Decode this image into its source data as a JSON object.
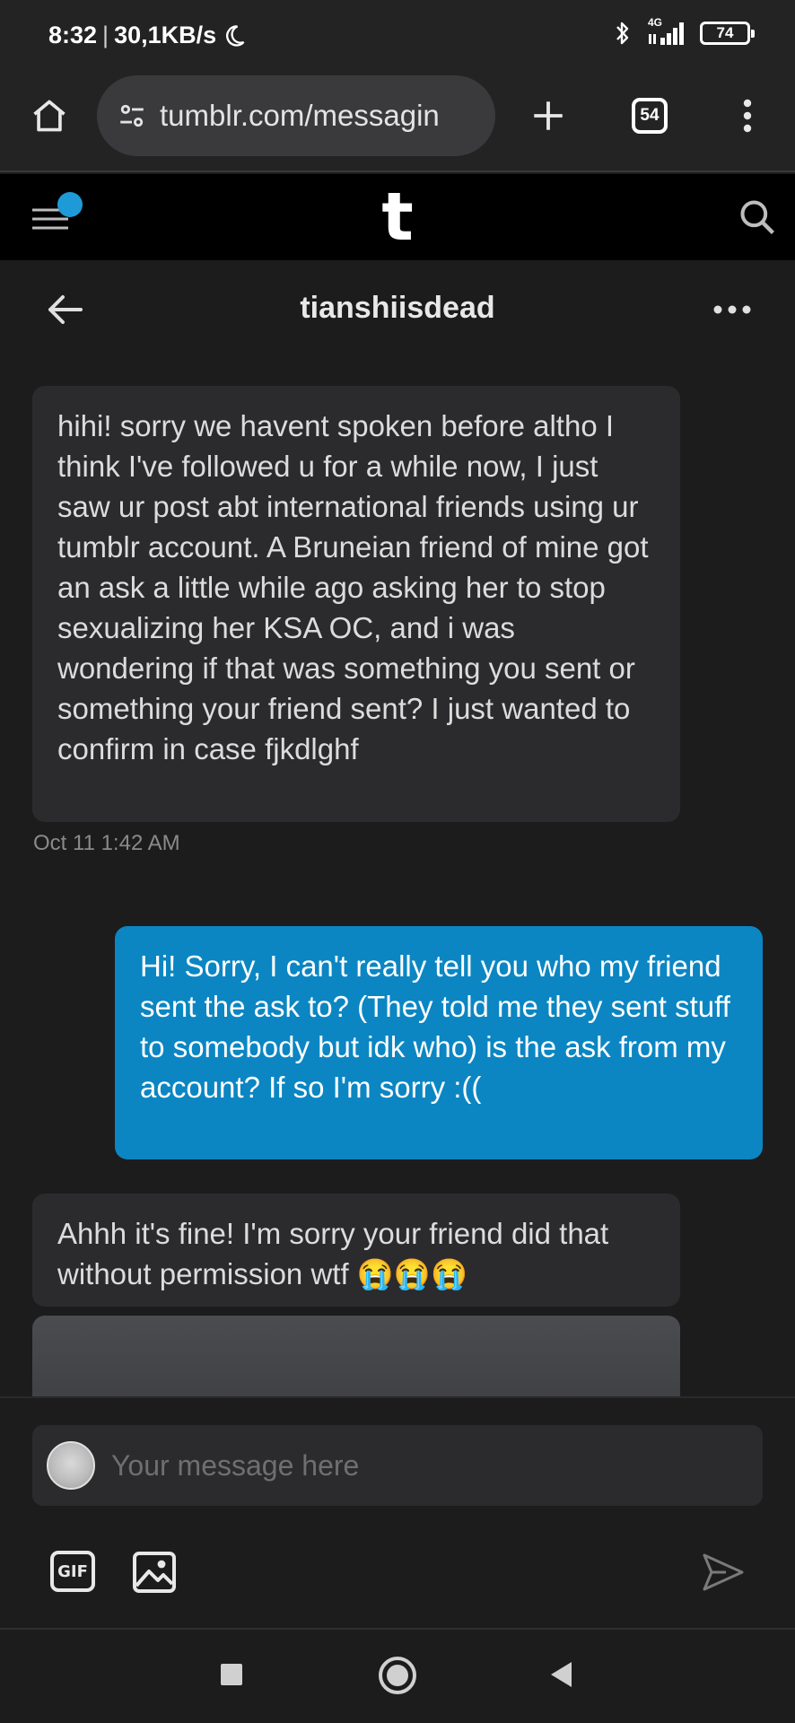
{
  "status_bar": {
    "time": "8:32",
    "speed": "30,1KB/s",
    "network": "4G",
    "battery": "74"
  },
  "browser": {
    "url": "tumblr.com/messagin",
    "tab_count": "54"
  },
  "conversation": {
    "title": "tianshiisdead"
  },
  "messages": [
    {
      "direction": "incoming",
      "text": "hihi! sorry we havent spoken before altho I think I've followed u for a while now, I just saw ur post abt international friends using ur tumblr account. A Bruneian friend of mine got an ask a little while ago asking her to stop sexualizing her KSA OC, and i was wondering if that was something you sent or something your friend sent? I just wanted to confirm in case fjkdlghf",
      "timestamp": "Oct 11 1:42 AM"
    },
    {
      "direction": "outgoing",
      "text": "Hi! Sorry, I can't really tell you who my friend sent the ask to? (They told me they sent stuff to somebody but idk who) is the ask from my account? If so I'm sorry :(("
    },
    {
      "direction": "incoming",
      "text": "Ahhh it's fine! I'm sorry your friend did that without permission wtf 😭😭😭"
    }
  ],
  "composer": {
    "placeholder": "Your message here",
    "gif_label": "GIF"
  },
  "colors": {
    "background": "#1c1c1d",
    "incoming_bubble": "#2b2b2d",
    "outgoing_bubble": "#0b86c3",
    "notification_dot": "#1e9bd7"
  },
  "icons": {
    "home": "home-icon",
    "site_settings": "tune-icon",
    "new_tab": "plus-icon",
    "menu": "more-vert-icon",
    "hamburger": "hamburger-icon",
    "search": "search-icon",
    "back": "arrow-left-icon",
    "conversation_options": "more-horiz-icon",
    "image": "image-icon",
    "send": "send-icon"
  }
}
